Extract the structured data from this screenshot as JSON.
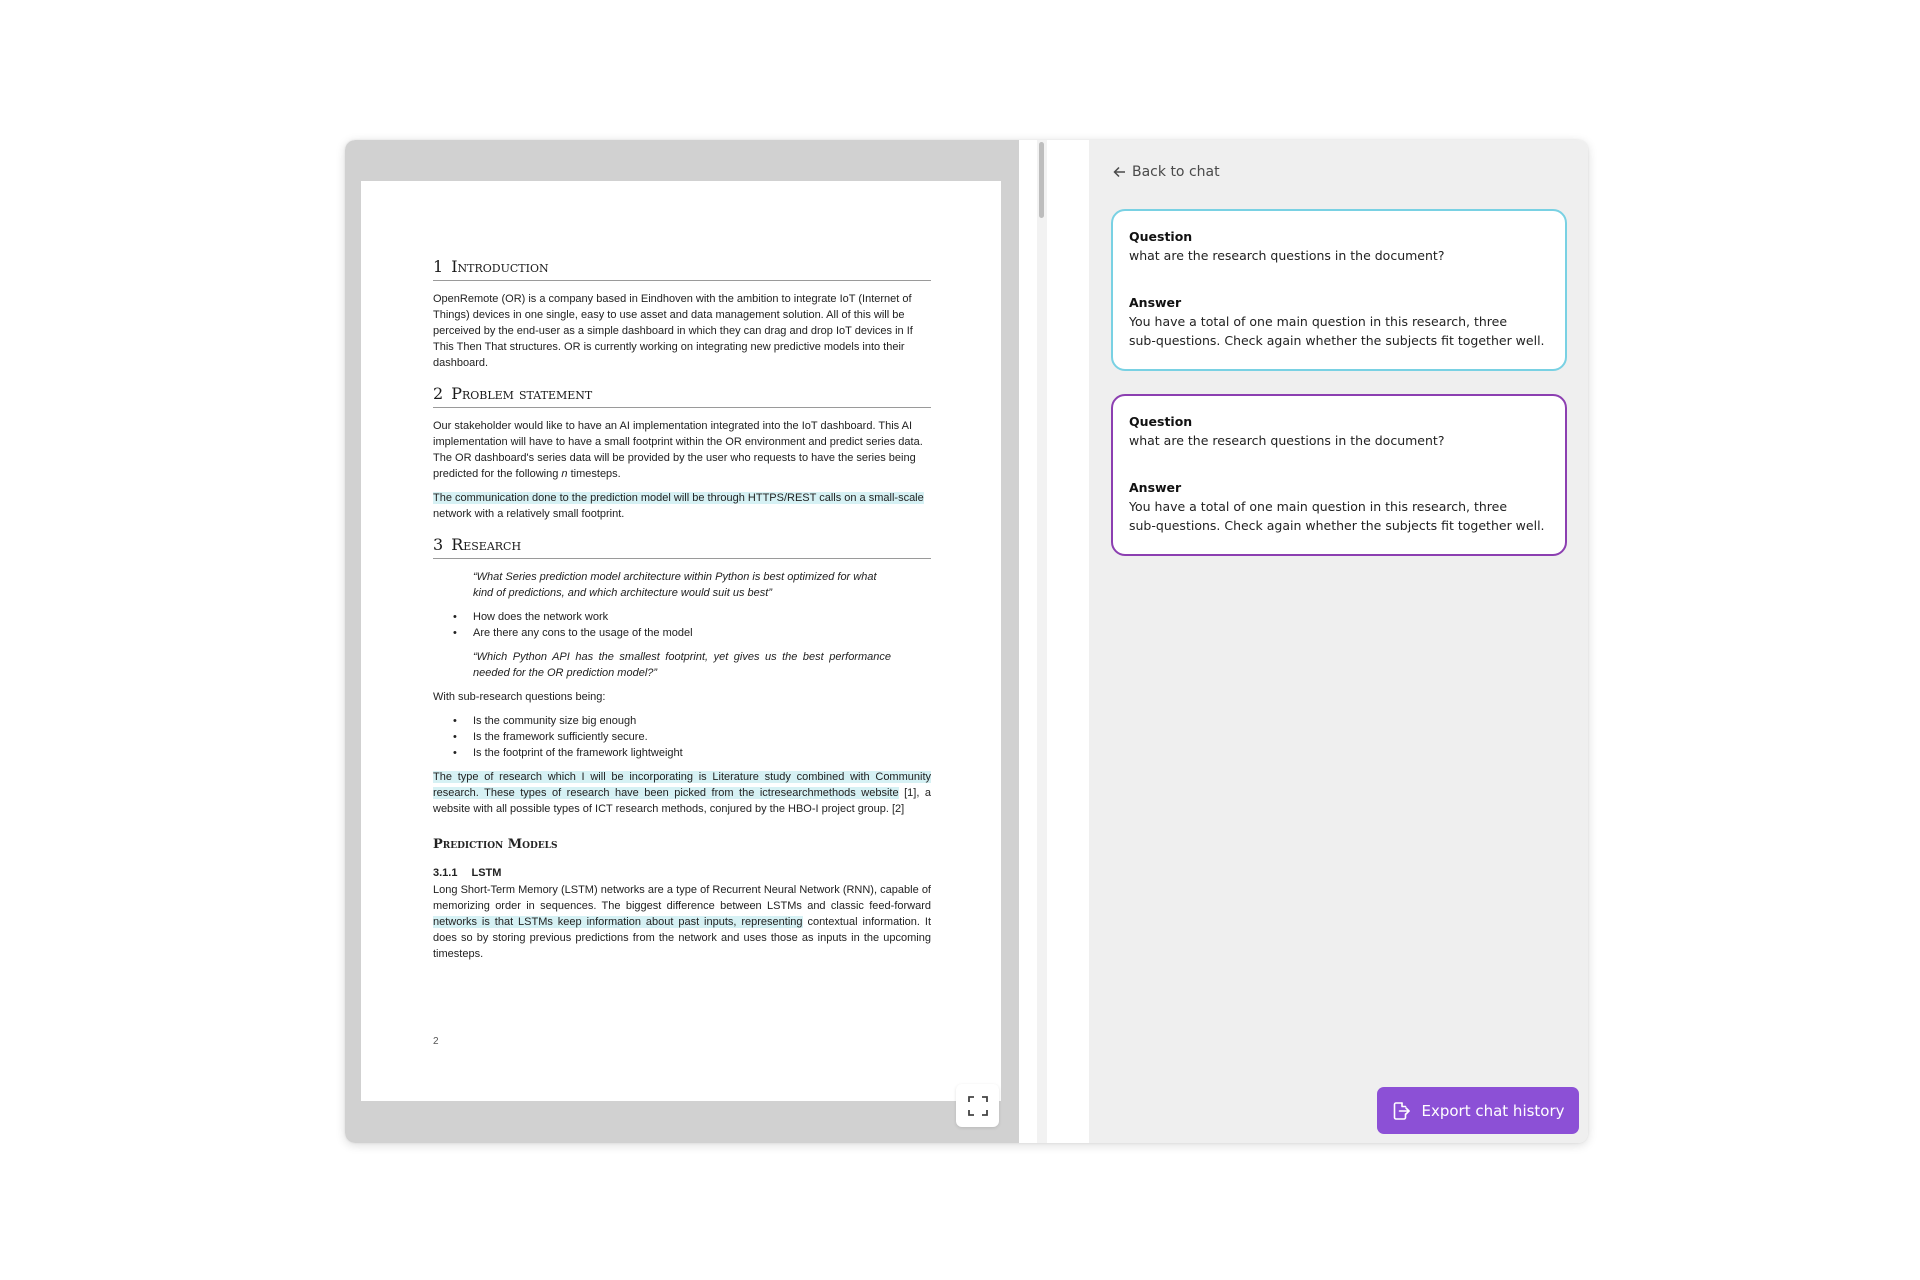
{
  "document": {
    "sections": {
      "intro": {
        "number": "1",
        "title": "Introduction",
        "paragraph": "OpenRemote (OR) is a company based in Eindhoven with the ambition to integrate IoT (Internet of Things) devices in one single, easy to use asset and data management solution. All of this will be perceived by the end-user as a simple dashboard in which they can drag and drop IoT devices in If This Then That structures. OR is currently working on integrating new predictive models into their dashboard."
      },
      "problem": {
        "number": "2",
        "title": "Problem statement",
        "paragraph_before_n": "Our stakeholder would like to have an AI implementation integrated into the IoT dashboard. This AI implementation will have to have a small footprint within the OR environment and predict series data. The OR dashboard's series data will be provided by the user who requests to have the series being predicted for the following ",
        "paragraph_n": "n",
        "paragraph_after_n": " timesteps.",
        "highlight": "The communication done to the prediction model will be through HTTPS/REST calls on a small-scale",
        "highlight_rest": " network with a relatively small footprint."
      },
      "research": {
        "number": "3",
        "title": "Research",
        "quote1": "“What Series prediction model architecture within Python is best optimized for what kind of predictions, and which architecture would suit us best”",
        "bullets1": [
          "How does the network work",
          "Are there any cons to the usage of the model"
        ],
        "quote2": "“Which Python API has the smallest footprint, yet gives us the best performance needed for the OR prediction model?”",
        "sub_intro": "With sub-research questions being:",
        "bullets2": [
          "Is the community size big enough",
          "Is the framework sufficiently secure.",
          "Is the footprint of the framework lightweight"
        ],
        "highlight": "The type of research which I will be incorporating is Literature study combined with Community research. These types of research have been picked from the ictresearchmethods website",
        "highlight_rest": " [1], a website with all possible types of ICT research methods, conjured by the HBO-I project group. [2]"
      },
      "prediction": {
        "title": "Prediction Models",
        "sub_number": "3.1.1",
        "sub_title": "LSTM",
        "text_before": "Long Short-Term Memory (LSTM) networks are a type of Recurrent Neural Network (RNN), capable of memorizing order in sequences. The biggest difference between LSTMs and classic feed-forward ",
        "highlight": "networks is that LSTMs keep information about past inputs, representing",
        "text_after": " contextual information. It does so by storing previous predictions from the network and uses those as inputs in the upcoming timesteps."
      }
    },
    "page_number": "2"
  },
  "viewer": {
    "expand_icon": "expand-icon"
  },
  "chat": {
    "back_label": "Back to chat",
    "back_icon": "arrow-left-icon",
    "cards": [
      {
        "question_label": "Question",
        "question": "what are the research questions in the document?",
        "answer_label": "Answer",
        "answer_line1": "You have a total of one main question in this research, three",
        "answer_line2": "sub-questions. Check again whether the subjects fit together well.",
        "border_color": "#79d1e3"
      },
      {
        "question_label": "Question",
        "question": "what are the research questions in the document?",
        "answer_label": "Answer",
        "answer_line1": "You have a total of one main question in this research, three",
        "answer_line2": "sub-questions. Check again whether the subjects fit together well.",
        "border_color": "#8c3fb1"
      }
    ],
    "export_label": "Export chat history",
    "export_icon": "export-file-icon"
  },
  "colors": {
    "highlight": "#d6f1f4",
    "accent": "#8c50d6",
    "chat_background": "#efefef",
    "viewer_background": "#d1d1d1"
  }
}
